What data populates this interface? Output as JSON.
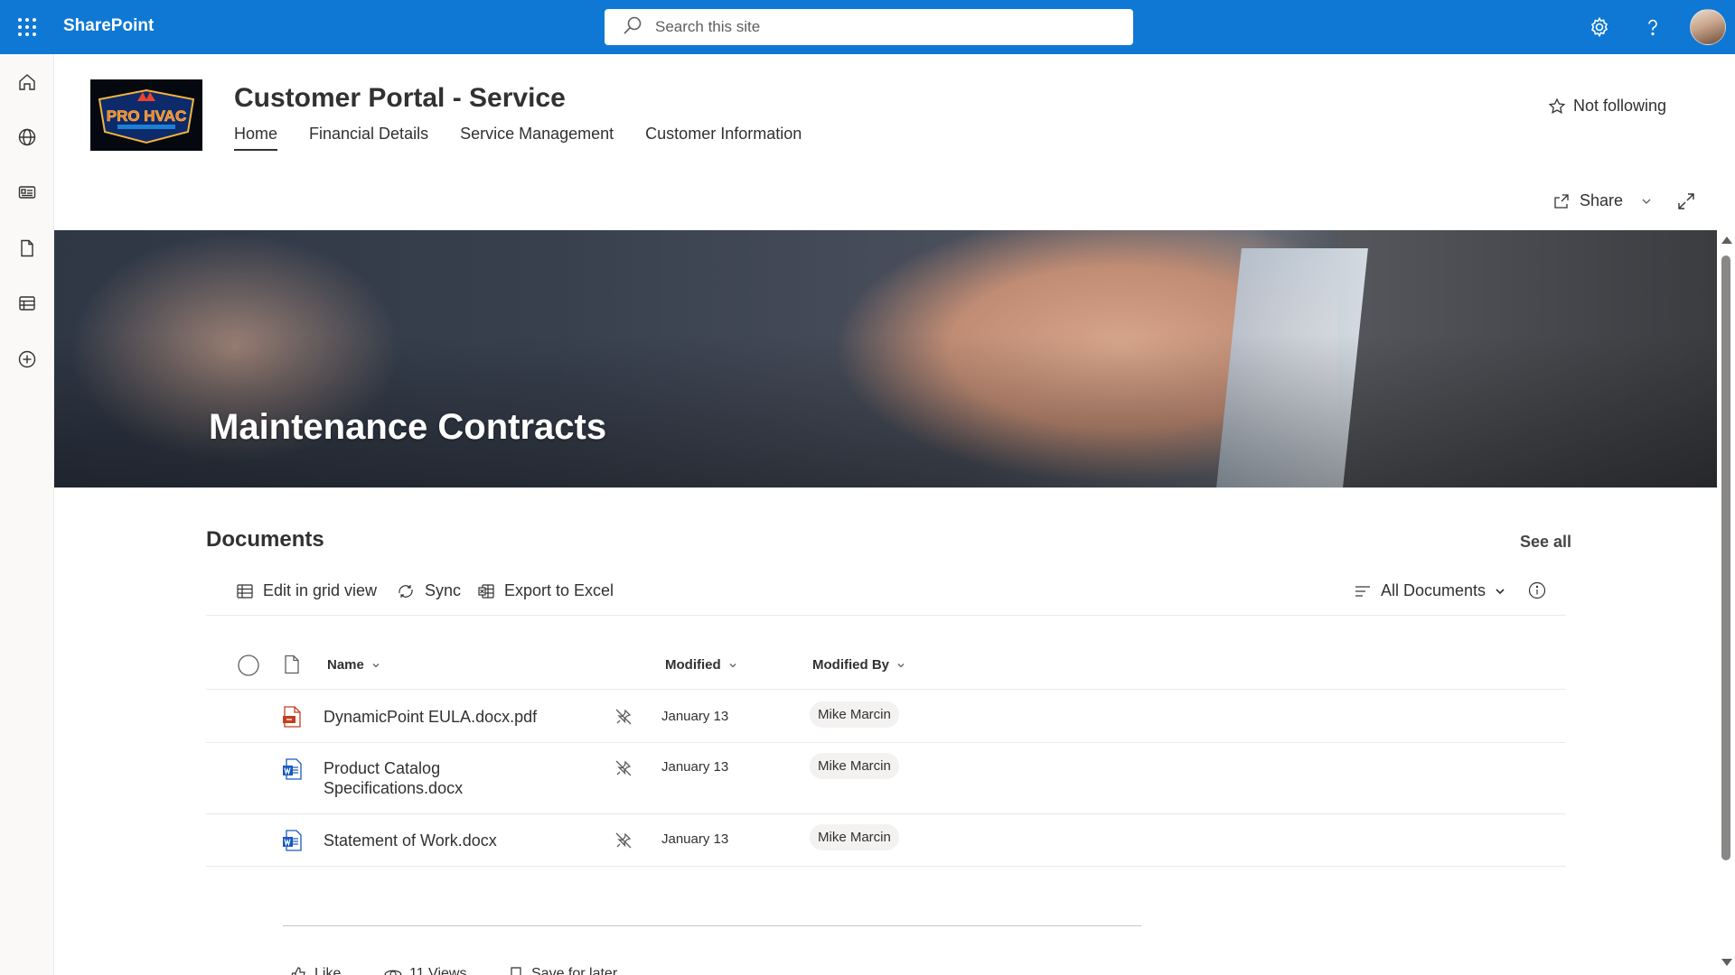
{
  "app": {
    "name": "SharePoint"
  },
  "search": {
    "placeholder": "Search this site"
  },
  "site": {
    "title": "Customer Portal - Service",
    "logo_text": "PRO HVAC",
    "nav": [
      {
        "label": "Home",
        "active": true
      },
      {
        "label": "Financial Details"
      },
      {
        "label": "Service Management"
      },
      {
        "label": "Customer Information"
      }
    ],
    "follow_label": "Not following",
    "share_label": "Share"
  },
  "hero": {
    "title": "Maintenance Contracts"
  },
  "documents": {
    "title": "Documents",
    "see_all": "See all",
    "commands": {
      "edit_grid": "Edit in grid view",
      "sync": "Sync",
      "export": "Export to Excel",
      "view": "All Documents"
    },
    "columns": {
      "name": "Name",
      "modified": "Modified",
      "modified_by": "Modified By"
    },
    "rows": [
      {
        "type": "pdf",
        "name": "DynamicPoint EULA.docx.pdf",
        "modified": "January 13",
        "modified_by": "Mike Marcin"
      },
      {
        "type": "word",
        "name": "Product Catalog Specifications.docx",
        "modified": "January 13",
        "modified_by": "Mike Marcin"
      },
      {
        "type": "word",
        "name": "Statement of Work.docx",
        "modified": "January 13",
        "modified_by": "Mike Marcin"
      }
    ]
  },
  "footer": {
    "like": "Like",
    "views": "11 Views",
    "save": "Save for later"
  },
  "colors": {
    "suitebar": "#0f78d4",
    "text": "#323130",
    "word_blue": "#185abd",
    "pdf_red": "#c43e1c"
  }
}
